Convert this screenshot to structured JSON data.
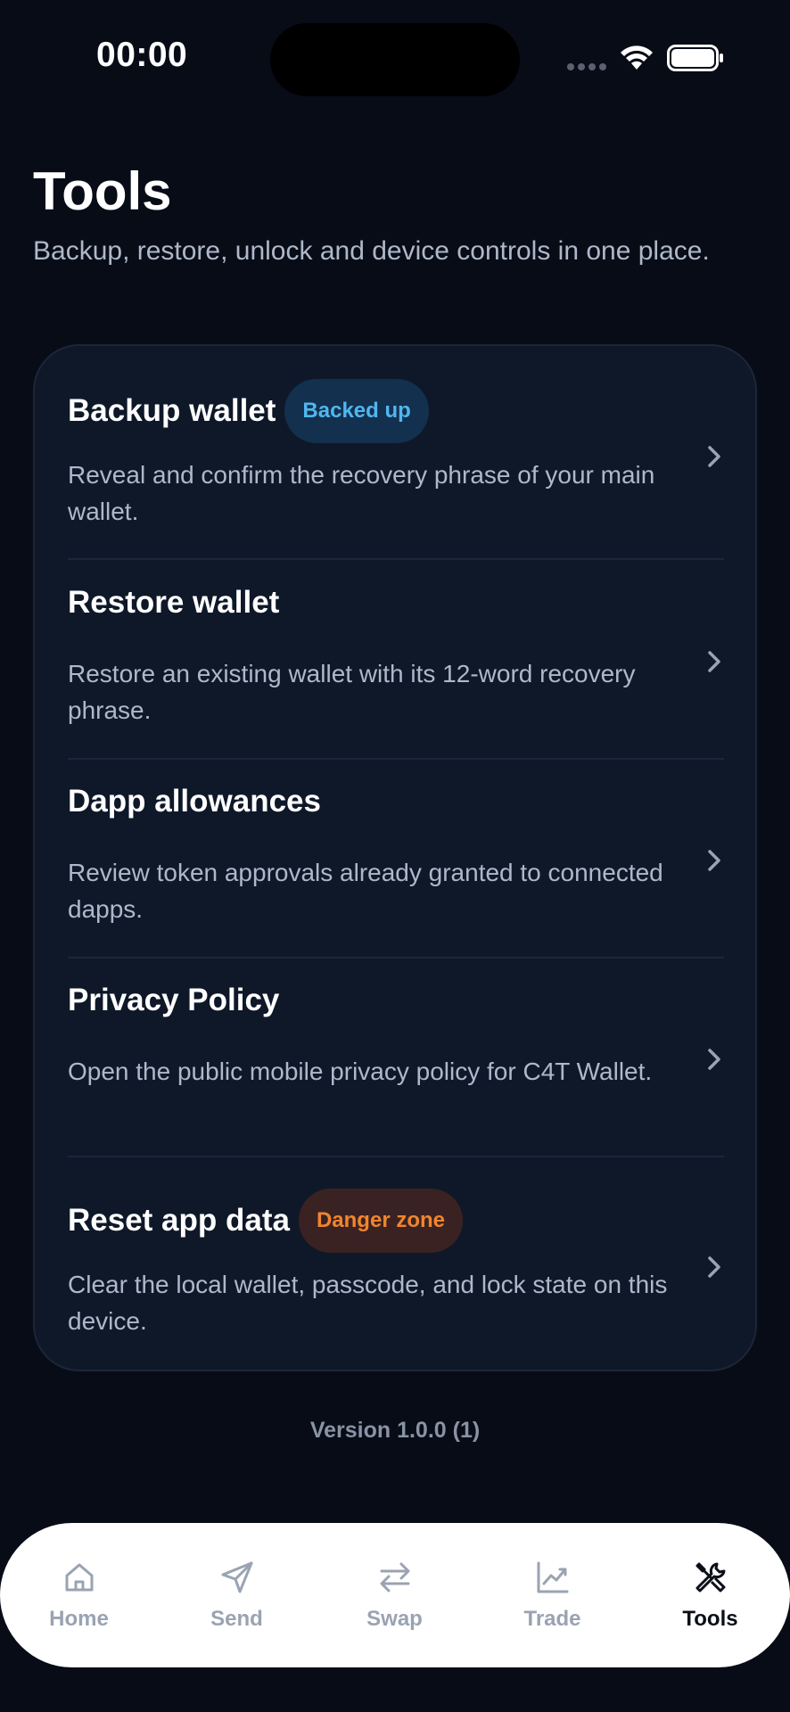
{
  "status_bar": {
    "time": "00:00"
  },
  "header": {
    "title": "Tools",
    "subtitle": "Backup, restore, unlock and device controls in one place."
  },
  "tools": [
    {
      "title": "Backup wallet",
      "badge": "Backed up",
      "badge_color": "#4fb7ef",
      "description": "Reveal and confirm the recovery phrase of your main wallet."
    },
    {
      "title": "Restore wallet",
      "description": "Restore an existing wallet with its 12-word recovery phrase."
    },
    {
      "title": "Dapp allowances",
      "description": "Review token approvals already granted to connected dapps."
    },
    {
      "title": "Privacy Policy",
      "description": "Open the public mobile privacy policy for C4T Wallet."
    },
    {
      "title": "Reset app data",
      "badge": "Danger zone",
      "badge_color": "#f0852f",
      "description": "Clear the local wallet, passcode, and lock state on this device."
    }
  ],
  "footer": {
    "version": "Version 1.0.0 (1)"
  },
  "tab_bar": {
    "items": [
      {
        "label": "Home",
        "icon": "home-icon"
      },
      {
        "label": "Send",
        "icon": "send-icon"
      },
      {
        "label": "Swap",
        "icon": "swap-icon"
      },
      {
        "label": "Trade",
        "icon": "trade-icon"
      },
      {
        "label": "Tools",
        "icon": "tools-icon",
        "active": true
      }
    ]
  },
  "colors": {
    "background": "#070c17",
    "card": "#0f1829",
    "text_secondary": "#aeb8c9",
    "accent_blue": "#4fb7ef",
    "accent_orange": "#f0852f"
  }
}
